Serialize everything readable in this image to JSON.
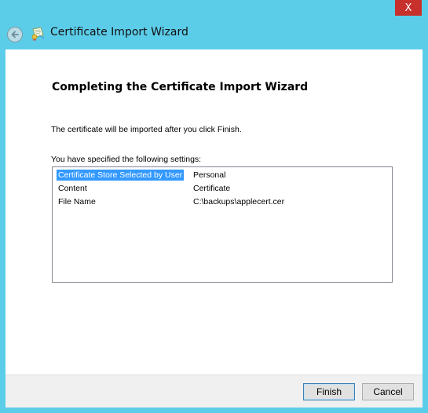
{
  "window": {
    "title": "Certificate Import Wizard",
    "close_label": "X"
  },
  "page": {
    "heading": "Completing the Certificate Import Wizard",
    "info_text": "The certificate will be imported after you click Finish.",
    "settings_label": "You have specified the following settings:"
  },
  "settings": [
    {
      "name": "Certificate Store Selected by User",
      "value": "Personal",
      "selected": true
    },
    {
      "name": "Content",
      "value": "Certificate",
      "selected": false
    },
    {
      "name": "File Name",
      "value": "C:\\backups\\applecert.cer",
      "selected": false
    }
  ],
  "buttons": {
    "finish": "Finish",
    "cancel": "Cancel"
  },
  "colors": {
    "frame": "#5ccde9",
    "close": "#c7302b",
    "selection": "#3399ff"
  },
  "icons": {
    "back": "back-arrow-icon",
    "app": "certificate-icon",
    "close": "close-icon"
  }
}
